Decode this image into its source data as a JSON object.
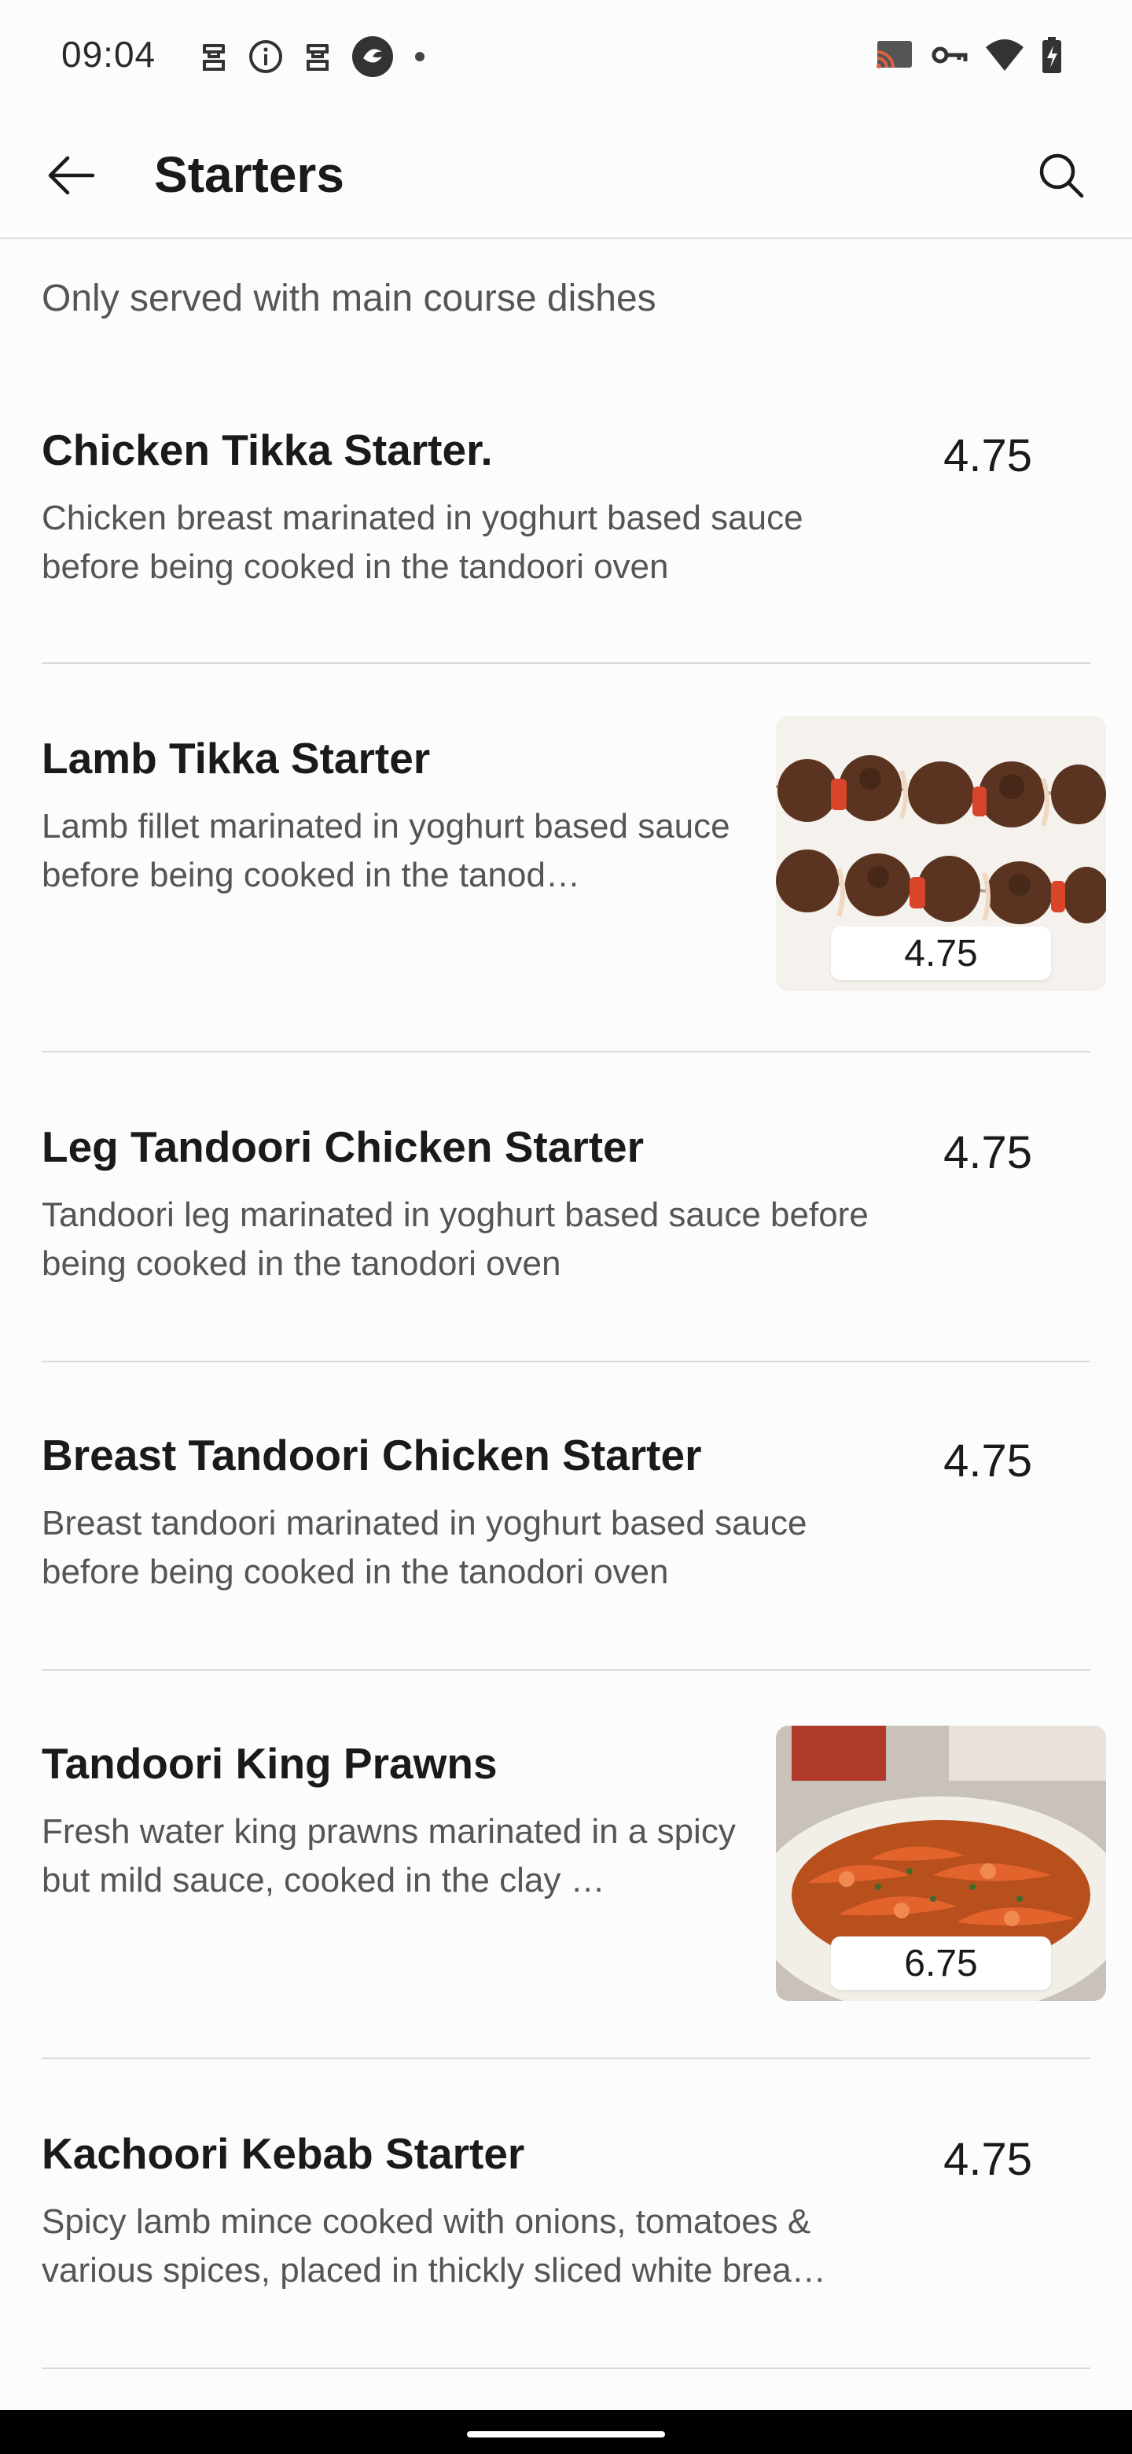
{
  "status_bar": {
    "time": "09:04",
    "left_icons": [
      "notification-icon",
      "info-icon",
      "notification-icon",
      "app-icon",
      "dot-icon"
    ],
    "right_icons": [
      "cast-icon",
      "vpn-key-icon",
      "wifi-icon",
      "battery-charging-icon"
    ]
  },
  "app_bar": {
    "title": "Starters",
    "back_icon": "arrow-back-icon",
    "search_icon": "search-icon"
  },
  "section_note": "Only served with main course dishes",
  "items": [
    {
      "name": "Chicken Tikka Starter.",
      "description": "Chicken breast marinated in yoghurt based sauce before being cooked in the tandoori oven",
      "price": "4.75",
      "has_image": false
    },
    {
      "name": "Lamb Tikka Starter",
      "description": "Lamb fillet marinated in yoghurt based sauce before being cooked in the tanod…",
      "price": "4.75",
      "has_image": true,
      "image": "lamb-skewers-photo"
    },
    {
      "name": "Leg Tandoori Chicken Starter",
      "description": "Tandoori leg marinated in yoghurt based sauce before being cooked in the tanodori oven",
      "price": "4.75",
      "has_image": false
    },
    {
      "name": "Breast Tandoori Chicken Starter",
      "description": "Breast tandoori marinated in yoghurt based sauce before being cooked in the tanodori oven",
      "price": "4.75",
      "has_image": false
    },
    {
      "name": "Tandoori King Prawns",
      "description": "Fresh water king prawns marinated in a spicy but mild sauce, cooked in the clay …",
      "price": "6.75",
      "has_image": true,
      "image": "king-prawns-photo"
    },
    {
      "name": "Kachoori Kebab Starter",
      "description": "Spicy lamb mince cooked with onions, tomatoes & various spices, placed in thickly sliced white brea…",
      "price": "4.75",
      "has_image": false
    }
  ],
  "colors": {
    "background": "#fcfcfc",
    "text_primary": "#1a1a1a",
    "text_secondary": "#555555",
    "divider": "#d9d9d9"
  }
}
